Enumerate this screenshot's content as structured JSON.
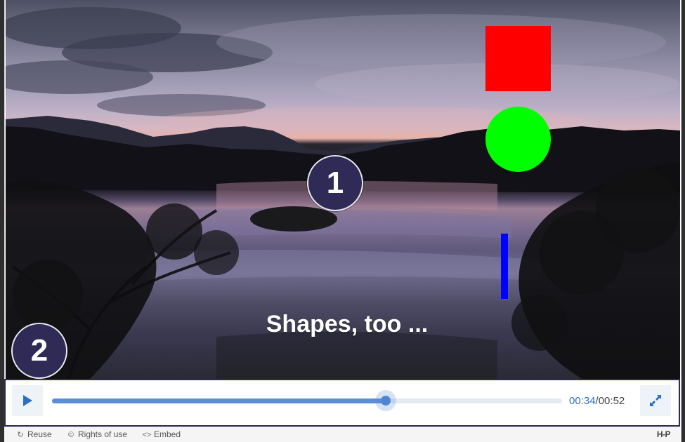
{
  "video": {
    "overlay_text": "Shapes, too ...",
    "hotspots": [
      {
        "label": "1"
      },
      {
        "label": "2"
      }
    ],
    "shapes": {
      "square_color": "#ff0000",
      "circle_color": "#00ff00",
      "line_color": "#0000ff"
    }
  },
  "controls": {
    "play_icon": "play-icon",
    "fullscreen_icon": "fullscreen-icon",
    "current_time": "00:34",
    "separator": "/",
    "total_time": "00:52",
    "progress_fraction": 0.6538
  },
  "footer": {
    "reuse": "Reuse",
    "rights": "Rights of use",
    "embed": "Embed",
    "logo": "H-P"
  },
  "colors": {
    "accent": "#2f2a56",
    "seek_fill": "#5b8ed6",
    "time_current": "#2a6fc9"
  }
}
